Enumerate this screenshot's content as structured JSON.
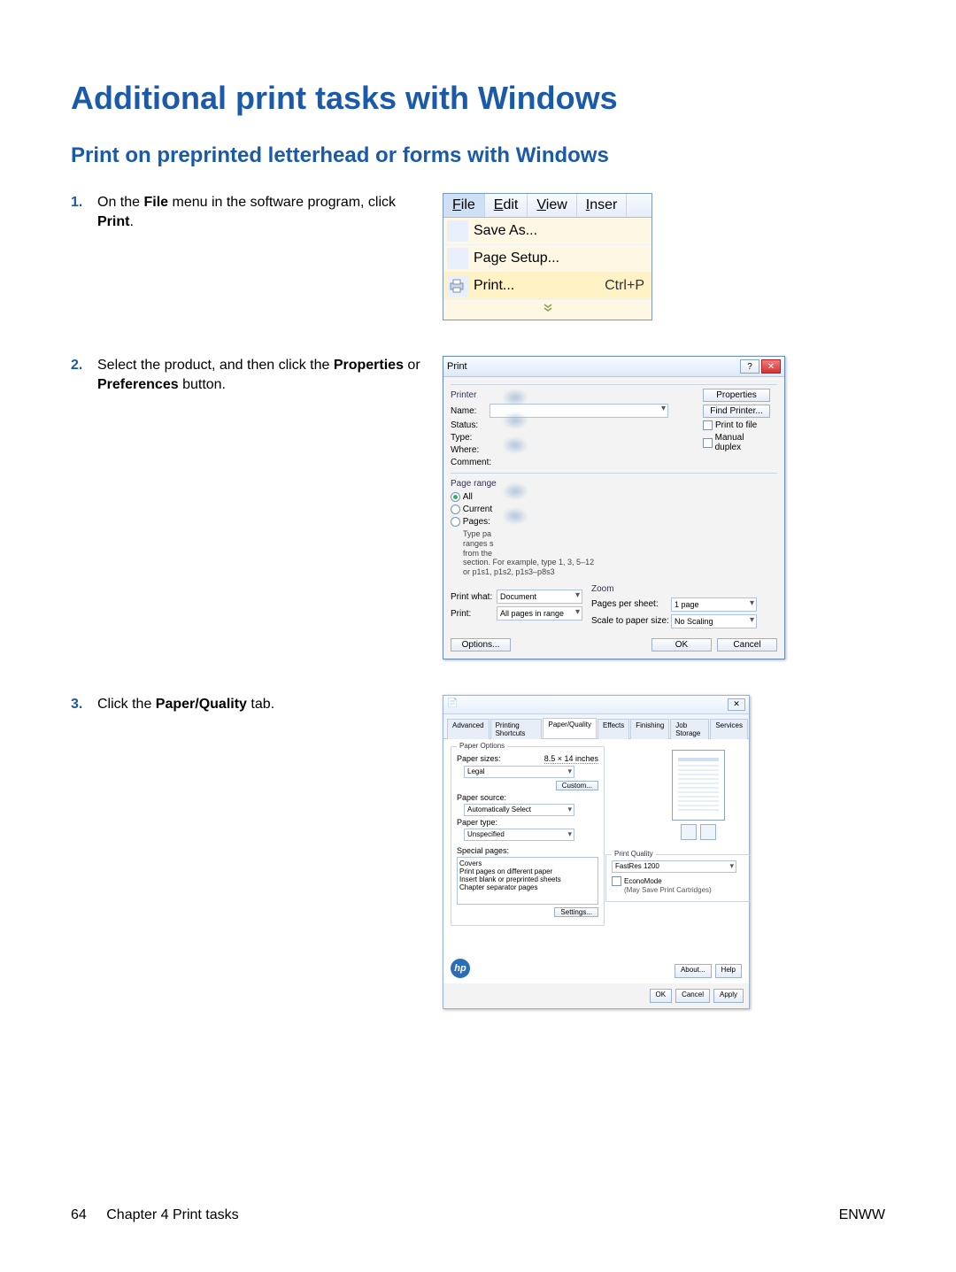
{
  "page": {
    "title": "Additional print tasks with Windows",
    "subtitle": "Print on preprinted letterhead or forms with Windows",
    "footer_page_num": "64",
    "footer_chapter": "Chapter 4   Print tasks",
    "footer_right": "ENWW"
  },
  "steps": {
    "s1": {
      "num": "1.",
      "pre": "On the ",
      "bold1": "File",
      "mid": " menu in the software program, click ",
      "bold2": "Print",
      "post": "."
    },
    "s2": {
      "num": "2.",
      "pre": "Select the product, and then click the ",
      "bold1": "Properties",
      "mid": " or ",
      "bold2": "Preferences",
      "post": " button."
    },
    "s3": {
      "num": "3.",
      "pre": "Click the ",
      "bold1": "Paper/Quality",
      "post": " tab."
    }
  },
  "file_menu": {
    "tabs": {
      "file": "File",
      "edit": "Edit",
      "view": "View",
      "inser": "Inser"
    },
    "items": {
      "save_as": "Save As...",
      "page_setup": "Page Setup...",
      "print": "Print...",
      "print_shortcut": "Ctrl+P"
    }
  },
  "print_dialog": {
    "title": "Print",
    "printer_label": "Printer",
    "name": "Name:",
    "status": "Status:",
    "type": "Type:",
    "where": "Where:",
    "comment": "Comment:",
    "properties_btn": "Properties",
    "find_printer_btn": "Find Printer...",
    "print_to_file": "Print to file",
    "manual_duplex": "Manual duplex",
    "page_range": "Page range",
    "all": "All",
    "current": "Current",
    "pages": "Pages:",
    "type_hint1": "Type pa",
    "type_hint2": "ranges s",
    "type_hint3": "from the",
    "type_hint4": "section. For example, type 1, 3, 5–12",
    "type_hint5": "or p1s1, p1s2, p1s3–p8s3",
    "print_what": "Print what:",
    "print_what_val": "Document",
    "print": "Print:",
    "print_val": "All pages in range",
    "zoom": "Zoom",
    "pages_per_sheet": "Pages per sheet:",
    "pps_val": "1 page",
    "scale": "Scale to paper size:",
    "scale_val": "No Scaling",
    "options_btn": "Options...",
    "ok_btn": "OK",
    "cancel_btn": "Cancel"
  },
  "props_dialog": {
    "tabs": {
      "advanced": "Advanced",
      "printing_shortcuts": "Printing Shortcuts",
      "paper_quality": "Paper/Quality",
      "effects": "Effects",
      "finishing": "Finishing",
      "job_storage": "Job Storage",
      "services": "Services"
    },
    "paper_options": "Paper Options",
    "paper_sizes": "Paper sizes:",
    "paper_size_val": "8.5 × 14 inches",
    "legal": "Legal",
    "custom_btn": "Custom...",
    "paper_source": "Paper source:",
    "paper_source_val": "Automatically Select",
    "paper_type": "Paper type:",
    "paper_type_val": "Unspecified",
    "special_pages": "Special pages:",
    "sp1": "Covers",
    "sp2": "Print pages on different paper",
    "sp3": "Insert blank or preprinted sheets",
    "sp4": "Chapter separator pages",
    "settings_btn": "Settings...",
    "print_quality": "Print Quality",
    "pq_val": "FastRes 1200",
    "economode": "EconoMode",
    "economode_hint": "(May Save Print Cartridges)",
    "about_btn": "About...",
    "help_btn": "Help",
    "ok_btn": "OK",
    "cancel_btn": "Cancel",
    "apply_btn": "Apply",
    "hp": "hp"
  }
}
